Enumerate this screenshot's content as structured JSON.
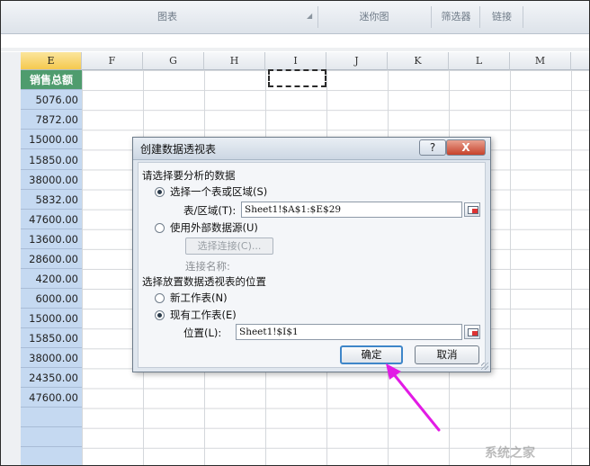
{
  "ribbon": {
    "groups": [
      "图表",
      "迷你图",
      "筛选器",
      "链接"
    ]
  },
  "columns": [
    "E",
    "F",
    "G",
    "H",
    "I",
    "J",
    "K",
    "L",
    "M"
  ],
  "column_e": {
    "header": "销售总额",
    "values": [
      "5076.00",
      "7872.00",
      "15000.00",
      "15850.00",
      "38000.00",
      "5832.00",
      "47600.00",
      "13600.00",
      "28600.00",
      "4200.00",
      "6000.00",
      "15000.00",
      "15850.00",
      "38000.00",
      "24350.00",
      "47600.00"
    ]
  },
  "dialog": {
    "title": "创建数据透视表",
    "help_label": "?",
    "close_label": "X",
    "section1": "请选择要分析的数据",
    "opt_table": "选择一个表或区域(S)",
    "range_label": "表/区域(T):",
    "range_value": "Sheet1!$A$1:$E$29",
    "opt_external": "使用外部数据源(U)",
    "choose_conn": "选择连接(C)...",
    "conn_name": "连接名称:",
    "section2": "选择放置数据透视表的位置",
    "opt_new": "新工作表(N)",
    "opt_existing": "现有工作表(E)",
    "location_label": "位置(L):",
    "location_value": "Sheet1!$I$1",
    "ok_label": "确定",
    "cancel_label": "取消"
  },
  "colors": {
    "arrow": "#e21be5",
    "selected_column": "#c5d9f1",
    "header_fill": "#4f9c6e"
  },
  "watermark": "系统之家"
}
